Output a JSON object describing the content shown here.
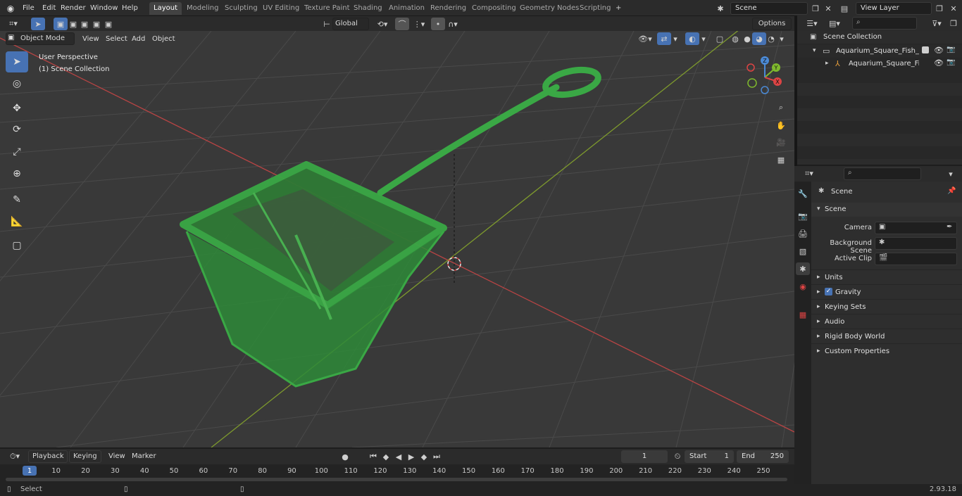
{
  "topbar": {
    "menus": [
      "File",
      "Edit",
      "Render",
      "Window",
      "Help"
    ],
    "workspace_tabs": [
      "Layout",
      "Modeling",
      "Sculpting",
      "UV Editing",
      "Texture Paint",
      "Shading",
      "Animation",
      "Rendering",
      "Compositing",
      "Geometry Nodes",
      "Scripting"
    ],
    "active_tab": "Layout",
    "add_tab": "+",
    "scene_value": "Scene",
    "view_layer_value": "View Layer"
  },
  "viewport_toolbar": {
    "transform_orientation": "Global",
    "options_label": "Options"
  },
  "viewport_header": {
    "mode": "Object Mode",
    "menus": [
      "View",
      "Select",
      "Add",
      "Object"
    ]
  },
  "viewport_overlay": {
    "perspective": "User Perspective",
    "collection": "(1) Scene Collection"
  },
  "gizmo": {
    "axes": [
      "X",
      "Y",
      "Z"
    ]
  },
  "outliner": {
    "root": "Scene Collection",
    "items": [
      {
        "label": "Aquarium_Square_Fish_Net_C"
      },
      {
        "label": "Aquarium_Square_Fish_N"
      }
    ]
  },
  "properties": {
    "context_title": "Scene",
    "section": "Scene",
    "fields": [
      {
        "label": "Camera"
      },
      {
        "label": "Background Scene"
      },
      {
        "label": "Active Clip"
      }
    ],
    "panels": [
      "Units",
      "Gravity",
      "Keying Sets",
      "Audio",
      "Rigid Body World",
      "Custom Properties"
    ]
  },
  "timeline": {
    "menus": [
      "Playback",
      "Keying",
      "View",
      "Marker"
    ],
    "current_frame": "1",
    "start_label": "Start",
    "start_value": "1",
    "end_label": "End",
    "end_value": "250",
    "ticks": [
      "1",
      "10",
      "20",
      "30",
      "40",
      "50",
      "60",
      "70",
      "80",
      "90",
      "100",
      "110",
      "120",
      "130",
      "140",
      "150",
      "160",
      "170",
      "180",
      "190",
      "200",
      "210",
      "220",
      "230",
      "240",
      "250"
    ]
  },
  "statusbar": {
    "left_label": "Select",
    "version": "2.93.18"
  },
  "colors": {
    "accent": "#4772b3",
    "net_green": "#3aa845",
    "x_axis": "#c04848",
    "y_axis": "#7e9a2d"
  }
}
